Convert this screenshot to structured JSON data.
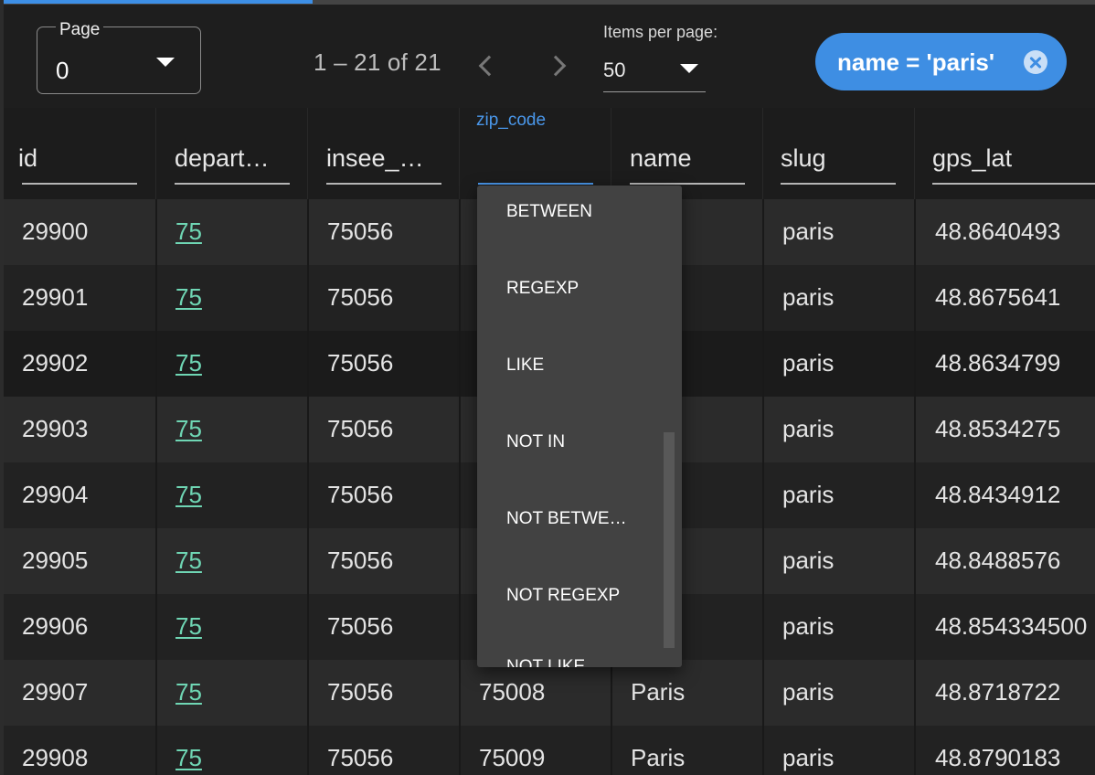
{
  "toolbar": {
    "page": {
      "label": "Page",
      "value": "0"
    },
    "range_text": "1 – 21 of 21",
    "items_per_page": {
      "label": "Items per page:",
      "value": "50"
    },
    "filter_chip": {
      "text": "name = 'paris'"
    }
  },
  "columns": [
    {
      "key": "id",
      "label": "id"
    },
    {
      "key": "department",
      "label": "depart…"
    },
    {
      "key": "insee",
      "label": "insee_…"
    },
    {
      "key": "zip_code",
      "label": "",
      "floating_label": "zip_code"
    },
    {
      "key": "name",
      "label": "name"
    },
    {
      "key": "slug",
      "label": "slug"
    },
    {
      "key": "gps_lat",
      "label": "gps_lat"
    }
  ],
  "rows": [
    {
      "id": "29900",
      "department": "75",
      "insee": "75056",
      "zip_code": "",
      "name": "",
      "slug": "paris",
      "gps_lat": "48.8640493"
    },
    {
      "id": "29901",
      "department": "75",
      "insee": "75056",
      "zip_code": "",
      "name": "",
      "slug": "paris",
      "gps_lat": "48.8675641"
    },
    {
      "id": "29902",
      "department": "75",
      "insee": "75056",
      "zip_code": "",
      "name": "",
      "slug": "paris",
      "gps_lat": "48.8634799"
    },
    {
      "id": "29903",
      "department": "75",
      "insee": "75056",
      "zip_code": "",
      "name": "",
      "slug": "paris",
      "gps_lat": "48.8534275"
    },
    {
      "id": "29904",
      "department": "75",
      "insee": "75056",
      "zip_code": "",
      "name": "",
      "slug": "paris",
      "gps_lat": "48.8434912"
    },
    {
      "id": "29905",
      "department": "75",
      "insee": "75056",
      "zip_code": "",
      "name": "",
      "slug": "paris",
      "gps_lat": "48.8488576"
    },
    {
      "id": "29906",
      "department": "75",
      "insee": "75056",
      "zip_code": "",
      "name": "",
      "slug": "paris",
      "gps_lat": "48.854334500"
    },
    {
      "id": "29907",
      "department": "75",
      "insee": "75056",
      "zip_code": "75008",
      "name": "Paris",
      "slug": "paris",
      "gps_lat": "48.8718722"
    },
    {
      "id": "29908",
      "department": "75",
      "insee": "75056",
      "zip_code": "75009",
      "name": "Paris",
      "slug": "paris",
      "gps_lat": "48.8790183"
    }
  ],
  "operator_dropdown": {
    "options": [
      "BETWEEN",
      "REGEXP",
      "LIKE",
      "NOT IN",
      "NOT BETWE…",
      "NOT REGEXP",
      "NOT LIKE"
    ]
  },
  "colors": {
    "accent": "#3e8ee3",
    "link": "#6fd6b4",
    "background": "#1d1d1d"
  },
  "icons": [
    "dropdown-caret-icon",
    "chevron-left-icon",
    "chevron-right-icon",
    "clear-filter-icon"
  ]
}
